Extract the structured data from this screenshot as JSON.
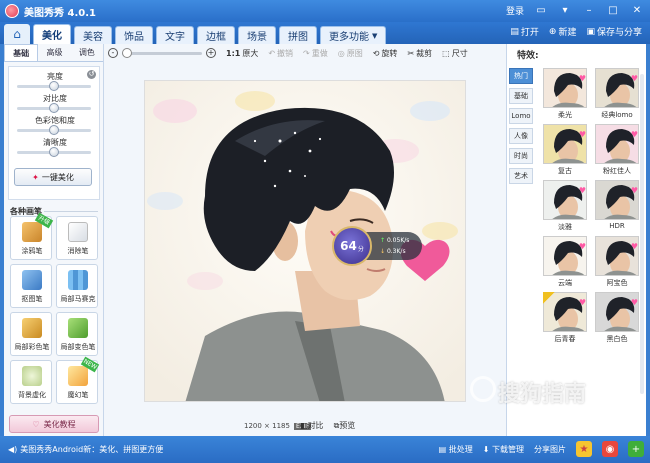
{
  "app": {
    "title": "美图秀秀 4.0.1"
  },
  "titlebar": {
    "login": "登录"
  },
  "tabs": [
    {
      "label": "美化",
      "active": true
    },
    {
      "label": "美容",
      "active": false
    },
    {
      "label": "饰品",
      "active": false
    },
    {
      "label": "文字",
      "active": false
    },
    {
      "label": "边框",
      "active": false
    },
    {
      "label": "场景",
      "active": false
    },
    {
      "label": "拼图",
      "active": false
    },
    {
      "label": "更多功能",
      "active": false
    }
  ],
  "top_actions": {
    "open": "打开",
    "new": "新建",
    "save_share": "保存与分享"
  },
  "left_panel": {
    "subtabs": [
      "基础",
      "高级",
      "调色"
    ],
    "sliders": [
      {
        "label": "亮度",
        "value": 0.5
      },
      {
        "label": "对比度",
        "value": 0.5
      },
      {
        "label": "色彩饱和度",
        "value": 0.5
      },
      {
        "label": "清晰度",
        "value": 0.5
      }
    ],
    "one_key": "一键美化",
    "pens_title": "各种画笔",
    "pens": [
      {
        "label": "涂鸦笔",
        "badge": "升级"
      },
      {
        "label": "消除笔",
        "badge": ""
      },
      {
        "label": "抠图笔",
        "badge": ""
      },
      {
        "label": "局部马赛克",
        "badge": ""
      },
      {
        "label": "局部彩色笔",
        "badge": ""
      },
      {
        "label": "局部变色笔",
        "badge": ""
      },
      {
        "label": "背景虚化",
        "badge": ""
      },
      {
        "label": "魔幻笔",
        "badge": "NEW"
      }
    ],
    "tutorial": "美化教程"
  },
  "toolbar": {
    "ratio": "1:1",
    "original_size": "原大",
    "undo": "撤销",
    "redo": "重做",
    "original": "原图",
    "rotate": "旋转",
    "crop": "裁剪",
    "size": "尺寸"
  },
  "canvas": {
    "image_info": "1200 × 1185",
    "exif": "EXIF",
    "compare": "对比",
    "preview": "预览"
  },
  "speed_widget": {
    "score": "64",
    "unit": "分",
    "up": "0.05K/s",
    "down": "0.3K/s"
  },
  "effects": {
    "title": "特效:",
    "categories": [
      {
        "label": "热门",
        "active": true
      },
      {
        "label": "基础",
        "active": false
      },
      {
        "label": "Lomo",
        "active": false
      },
      {
        "label": "人像",
        "active": false
      },
      {
        "label": "时尚",
        "active": false
      },
      {
        "label": "艺术",
        "active": false
      }
    ],
    "items": [
      {
        "label": "柔光",
        "hue": "#f3e7dc"
      },
      {
        "label": "经典lomo",
        "hue": "#e6e0d2"
      },
      {
        "label": "复古",
        "hue": "#efe2a8"
      },
      {
        "label": "粉红佳人",
        "hue": "#f6dde5"
      },
      {
        "label": "淡雅",
        "hue": "#eef0ee"
      },
      {
        "label": "HDR",
        "hue": "#dad8d2"
      },
      {
        "label": "云端",
        "hue": "#f7f4ee"
      },
      {
        "label": "阿宝色",
        "hue": "#e8e2da"
      },
      {
        "label": "后青春",
        "hue": "#efe9d8"
      },
      {
        "label": "黑白色",
        "hue": "#d8d8d8"
      }
    ]
  },
  "statusbar": {
    "message": "美图秀秀Android新：美化、拼图更方便",
    "batch": "批处理",
    "download": "下载管理",
    "share": "分享图片"
  },
  "watermark": {
    "text": "搜狗指南",
    "url": "zhinan.sogou.com"
  },
  "colors": {
    "accent": "#2a6fc9",
    "active_tab": "#ffffff",
    "category_active": "#4d8fd6"
  }
}
